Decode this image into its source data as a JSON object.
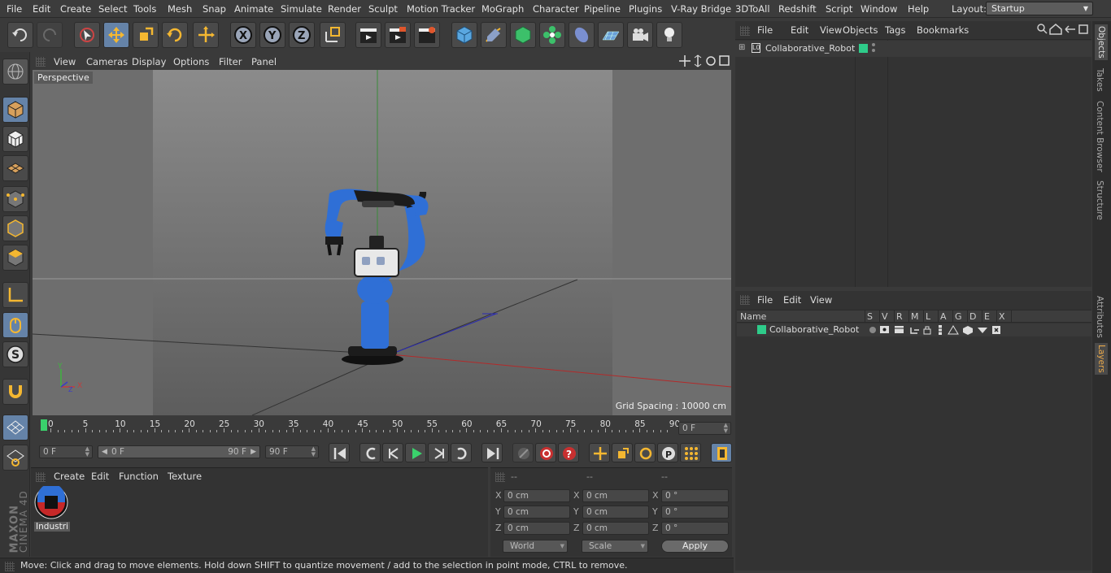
{
  "menubar": {
    "items": [
      "File",
      "Edit",
      "Create",
      "Select",
      "Tools",
      "Mesh",
      "Snap",
      "Animate",
      "Simulate",
      "Render",
      "Sculpt",
      "Motion Tracker",
      "MoGraph",
      "Character",
      "Pipeline",
      "Plugins",
      "V-Ray Bridge",
      "3DToAll",
      "Redshift",
      "Script",
      "Window",
      "Help"
    ],
    "layout_label": "Layout:",
    "layout_value": "Startup"
  },
  "viewport": {
    "menu": [
      "View",
      "Cameras",
      "Display",
      "Options",
      "Filter",
      "Panel"
    ],
    "camera_label": "Perspective",
    "grid_spacing": "Grid Spacing : 10000 cm",
    "axis_y": "Y",
    "axis_x": "X",
    "axis_z": "Z"
  },
  "timeline": {
    "ticks": [
      "0",
      "5",
      "10",
      "15",
      "20",
      "25",
      "30",
      "35",
      "40",
      "45",
      "50",
      "55",
      "60",
      "65",
      "70",
      "75",
      "80",
      "85",
      "90"
    ],
    "current_frame": "0 F"
  },
  "controls": {
    "start_frame": "0 F",
    "range_start": "0 F",
    "range_end": "90 F",
    "end_frame": "90 F"
  },
  "materials": {
    "menu": [
      "Create",
      "Edit",
      "Function",
      "Texture"
    ],
    "items": [
      {
        "label": "Industri"
      }
    ]
  },
  "coords": {
    "headers": [
      "--",
      "--",
      "--"
    ],
    "rows": [
      {
        "a": "X",
        "pos": "0 cm",
        "b": "X",
        "size": "0 cm",
        "c": "X",
        "rot": "0 °"
      },
      {
        "a": "Y",
        "pos": "0 cm",
        "b": "Y",
        "size": "0 cm",
        "c": "Y",
        "rot": "0 °"
      },
      {
        "a": "Z",
        "pos": "0 cm",
        "b": "Z",
        "size": "0 cm",
        "c": "Z",
        "rot": "0 °"
      }
    ],
    "mode": "World",
    "scale": "Scale",
    "apply": "Apply"
  },
  "objects": {
    "menu": [
      "File",
      "Edit",
      "View",
      "Objects",
      "Tags",
      "Bookmarks"
    ],
    "items": [
      {
        "name": "Collaborative_Robot",
        "color": "#2ecc8a"
      }
    ]
  },
  "layers": {
    "menu": [
      "File",
      "Edit",
      "View"
    ],
    "columns": [
      "Name",
      "S",
      "V",
      "R",
      "M",
      "L",
      "A",
      "G",
      "D",
      "E",
      "X"
    ],
    "items": [
      {
        "name": "Collaborative_Robot",
        "color": "#2ecc8a"
      }
    ]
  },
  "side_tabs": [
    "Objects",
    "Takes",
    "Content Browser",
    "Structure",
    "Attributes",
    "Layers"
  ],
  "status": "Move: Click and drag to move elements. Hold down SHIFT to quantize movement / add to the selection in point mode, CTRL to remove.",
  "brand": {
    "maxon": "MAXON",
    "product": "CINEMA 4D"
  },
  "colors": {
    "accent": "#6583a8",
    "robot_blue": "#2f6fd6",
    "layer_green": "#2ecc8a"
  }
}
